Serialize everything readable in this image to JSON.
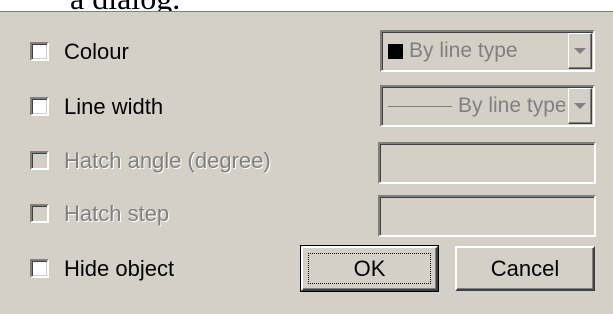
{
  "doc": {
    "fragment": "a dialog."
  },
  "rows": {
    "colour": {
      "label": "Colour"
    },
    "line_width": {
      "label": "Line width"
    },
    "hatch_angle": {
      "label": "Hatch angle (degree)"
    },
    "hatch_step": {
      "label": "Hatch step"
    },
    "hide_object": {
      "label": "Hide object"
    }
  },
  "combos": {
    "colour": {
      "value": "By line type",
      "icon": "black-swatch"
    },
    "line_width": {
      "value": "By line type",
      "icon": "line-sample"
    }
  },
  "buttons": {
    "ok": "OK",
    "cancel": "Cancel"
  },
  "colors": {
    "dialog_bg": "#d4d0c8",
    "disabled_text": "#808080"
  }
}
